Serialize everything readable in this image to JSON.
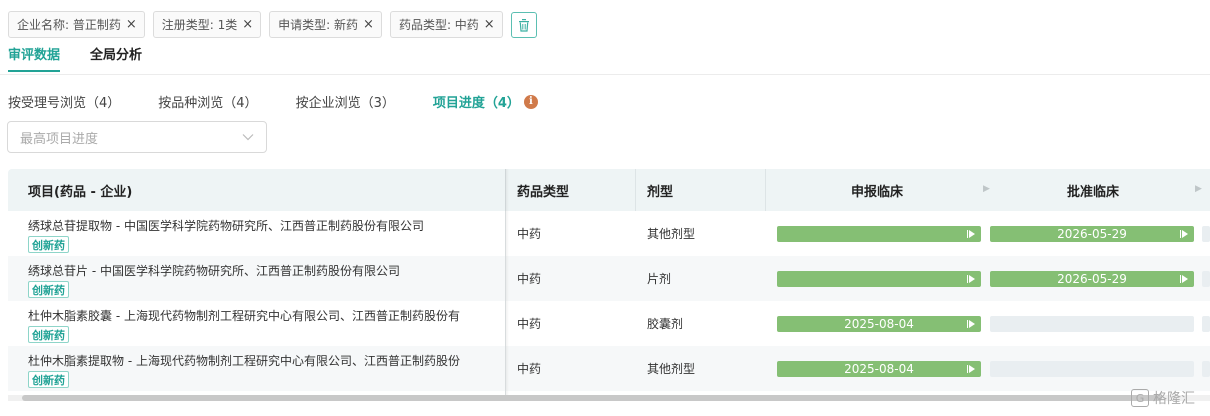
{
  "filters": [
    {
      "label": "企业名称: 普正制药"
    },
    {
      "label": "注册类型: 1类"
    },
    {
      "label": "申请类型: 新药"
    },
    {
      "label": "药品类型: 中药"
    }
  ],
  "chip_close": "×",
  "main_tabs": [
    {
      "label": "审评数据",
      "active": true
    },
    {
      "label": "全局分析",
      "active": false
    }
  ],
  "sub_tabs": [
    {
      "label": "按受理号浏览（4）"
    },
    {
      "label": "按品种浏览（4）"
    },
    {
      "label": "按企业浏览（3）"
    },
    {
      "label": "项目进度（4）",
      "active": true
    }
  ],
  "info_icon": "i",
  "progress_select": {
    "placeholder": "最高项目进度",
    "icon": "chevron-down-icon"
  },
  "table": {
    "headers": {
      "project": "项目(药品 - 企业)",
      "drug_type": "药品类型",
      "dosage_form": "剂型",
      "stage1": "申报临床",
      "stage2": "批准临床"
    },
    "rows": [
      {
        "project": "绣球总苷提取物 - 中国医学科学院药物研究所、江西普正制药股份有限公司",
        "tag": "创新药",
        "drug_type": "中药",
        "dosage_form": "其他剂型",
        "stage1_date": "",
        "stage1_done": true,
        "stage2_date": "2026-05-29",
        "stage2_done": true
      },
      {
        "project": "绣球总苷片 - 中国医学科学院药物研究所、江西普正制药股份有限公司",
        "tag": "创新药",
        "drug_type": "中药",
        "dosage_form": "片剂",
        "stage1_date": "",
        "stage1_done": true,
        "stage2_date": "2026-05-29",
        "stage2_done": true
      },
      {
        "project": "杜仲木脂素胶囊 - 上海现代药物制剂工程研究中心有限公司、江西普正制药股份有",
        "tag": "创新药",
        "drug_type": "中药",
        "dosage_form": "胶囊剂",
        "stage1_date": "2025-08-04",
        "stage1_done": true,
        "stage2_date": "",
        "stage2_done": false
      },
      {
        "project": "杜仲木脂素提取物 - 上海现代药物制剂工程研究中心有限公司、江西普正制药股份",
        "tag": "创新药",
        "drug_type": "中药",
        "dosage_form": "其他剂型",
        "stage1_date": "2025-08-04",
        "stage1_done": true,
        "stage2_date": "",
        "stage2_done": false
      }
    ]
  },
  "watermark": {
    "icon": "G",
    "text": "格隆汇"
  },
  "colors": {
    "accent": "#22a396",
    "bar_done": "#85bf74",
    "bar_empty": "#e9eef1",
    "info": "#d07a4a"
  }
}
